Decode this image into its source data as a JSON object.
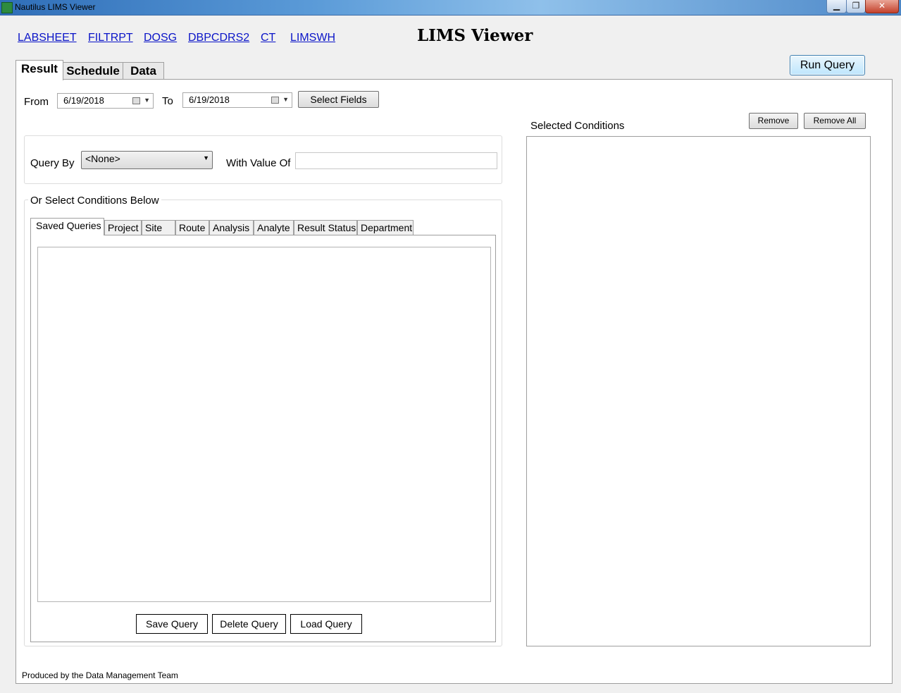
{
  "window": {
    "title": "Nautilus LIMS Viewer",
    "controls": {
      "minimize": "▁",
      "maximize": "❐",
      "close": "✕"
    }
  },
  "nav_links": [
    "LABSHEET",
    "FILTRPT",
    "DOSG",
    "DBPCDRS2",
    "CT",
    "LIMSWH"
  ],
  "header": {
    "title": "LIMS Viewer"
  },
  "run_query": "Run Query",
  "main_tabs": [
    "Result",
    "Schedule",
    "Data"
  ],
  "date_range": {
    "from_label": "From",
    "from_value": "6/19/2018",
    "to_label": "To",
    "to_value": "6/19/2018",
    "select_fields": "Select Fields"
  },
  "query": {
    "query_by_label": "Query By",
    "query_by_value": "<None>",
    "with_value_label": "With Value Of",
    "with_value": ""
  },
  "conditions": {
    "group_label": "Or Select Conditions Below",
    "tabs": [
      "Saved Queries",
      "Project",
      "Site",
      "Route",
      "Analysis",
      "Analyte",
      "Result Status",
      "Department"
    ],
    "buttons": {
      "save": "Save Query",
      "delete": "Delete Query",
      "load": "Load Query"
    }
  },
  "selected": {
    "label": "Selected Conditions",
    "remove": "Remove",
    "remove_all": "Remove All"
  },
  "footer": "Produced by the Data Management Team",
  "colors": {
    "link": "#0a14c8",
    "titlebar": "#2f6eb8",
    "run_query_border": "#3c7fb1"
  }
}
